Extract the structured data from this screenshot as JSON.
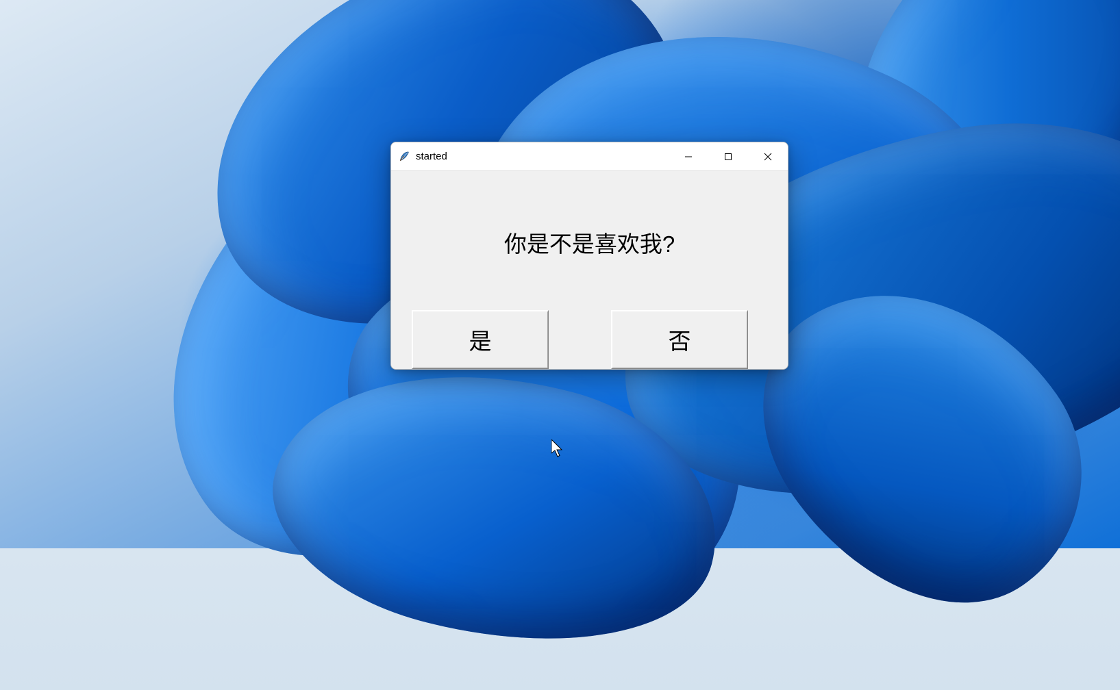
{
  "window": {
    "title": "started",
    "icon_name": "tk-feather-icon"
  },
  "dialog": {
    "question": "你是不是喜欢我?",
    "yes_label": "是",
    "no_label": "否"
  },
  "titlebar_controls": {
    "minimize": "minimize",
    "maximize": "maximize",
    "close": "close"
  }
}
